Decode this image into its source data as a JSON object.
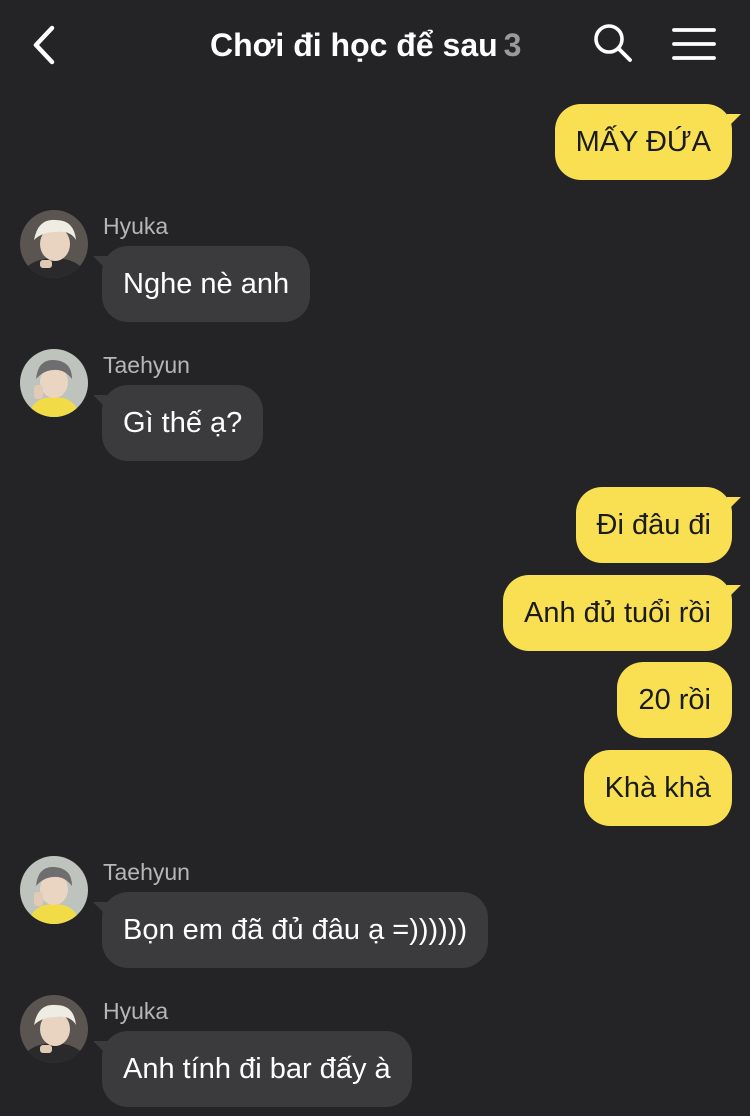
{
  "header": {
    "title": "Chơi đi học để sau",
    "member_count": "3",
    "back_icon": "chevron-left-icon",
    "search_icon": "search-icon",
    "menu_icon": "hamburger-menu-icon"
  },
  "messages": [
    {
      "direction": "out",
      "text": "MẤY ĐỨA"
    },
    {
      "direction": "in",
      "sender": "Hyuka",
      "text": "Nghe nè anh"
    },
    {
      "direction": "in",
      "sender": "Taehyun",
      "text": "Gì thế ạ?"
    },
    {
      "direction": "out",
      "text": "Đi đâu đi"
    },
    {
      "direction": "out",
      "text": "Anh đủ tuổi rồi"
    },
    {
      "direction": "out",
      "text": "20 rồi"
    },
    {
      "direction": "out",
      "text": "Khà khà"
    },
    {
      "direction": "in",
      "sender": "Taehyun",
      "text": "Bọn em đã đủ đâu ạ =))))))"
    },
    {
      "direction": "in",
      "sender": "Hyuka",
      "text": "Anh tính đi bar đấy à"
    }
  ],
  "colors": {
    "background": "#242426",
    "incoming_bubble": "#3b3b3d",
    "outgoing_bubble": "#f9e053",
    "sender_name": "#b6b6b8",
    "member_count": "#9a9a9c"
  }
}
